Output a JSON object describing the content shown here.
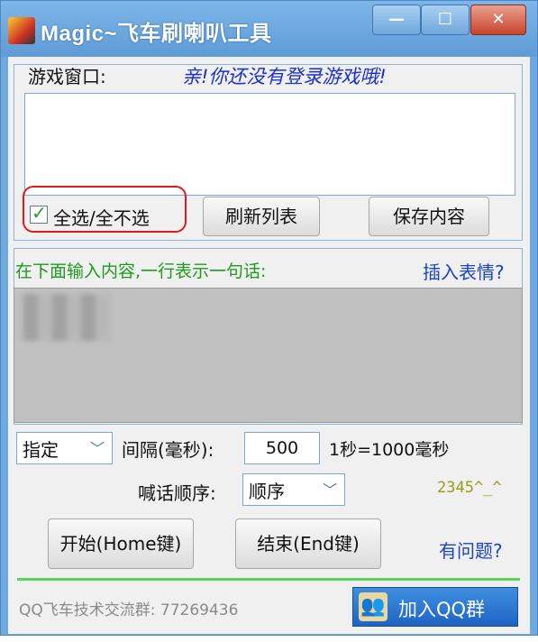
{
  "window": {
    "title": "Magic~飞车刷喇叭工具",
    "minimize_glyph": "—",
    "maximize_glyph": "☐",
    "close_glyph": "✕"
  },
  "game_section": {
    "label": "游戏窗口:",
    "status_text": "亲!你还没有登录游戏哦!",
    "select_all_label": "全选/全不选",
    "select_all_checked": true,
    "refresh_button": "刷新列表",
    "save_button": "保存内容"
  },
  "message_section": {
    "instruction": "在下面输入内容,一行表示一句话:",
    "insert_emoji_link": "插入表情?"
  },
  "settings": {
    "mode_value": "指定",
    "interval_label": "间隔(毫秒):",
    "interval_value": "500",
    "interval_hint": "1秒=1000毫秒",
    "order_label": "喊话顺序:",
    "order_value": "顺序",
    "counter_text": "2345^_^"
  },
  "actions": {
    "start_button": "开始(Home键)",
    "stop_button": "结束(End键)",
    "help_link": "有问题?"
  },
  "footer": {
    "group_text": "QQ飞车技术交流群: 77269436",
    "join_button": "加入QQ群"
  },
  "colors": {
    "title_bar": "#6fa9de",
    "status_blue": "#1a2fcf",
    "instruction_green": "#1e9a1e",
    "counter_olive": "#9a9a1a",
    "link_blue": "#1a44c8",
    "highlight_red": "#e01a1a"
  }
}
